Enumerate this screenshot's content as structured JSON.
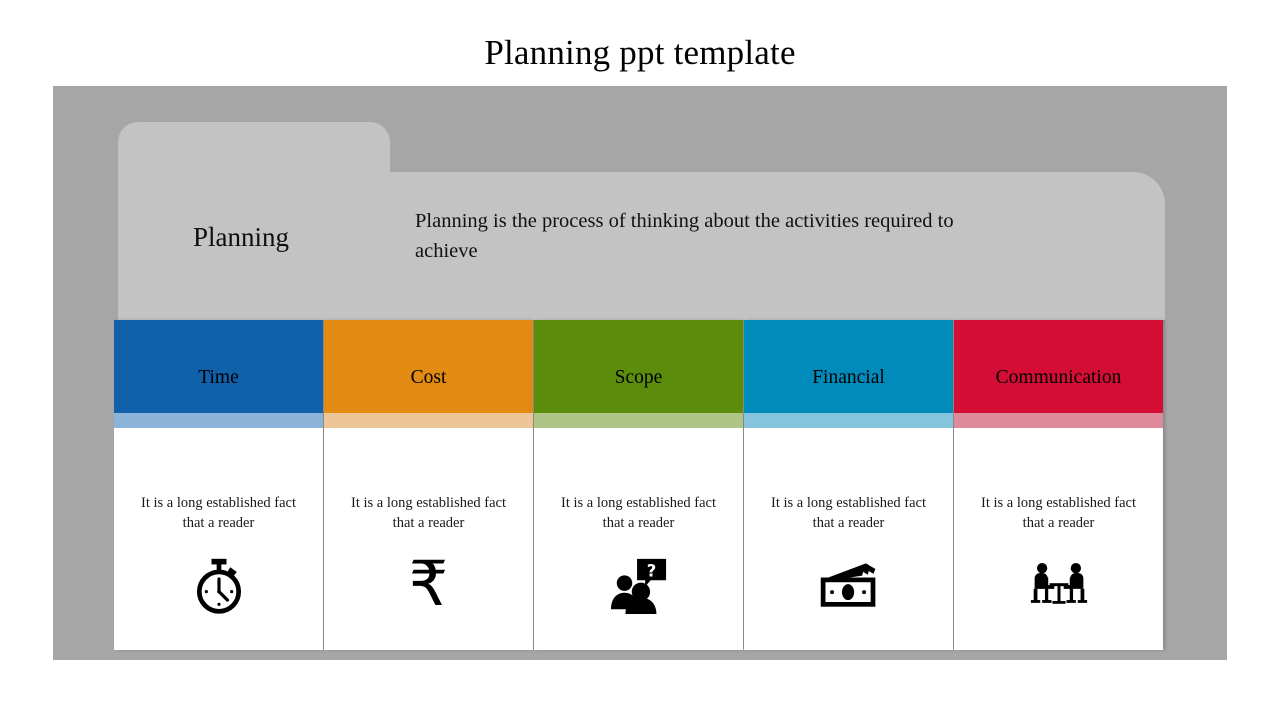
{
  "slide": {
    "title": "Planning ppt template",
    "background_color": "#ffffff",
    "frame_color": "#a6a6a6",
    "panel_color": "#c3c3c3"
  },
  "header": {
    "heading": "Planning",
    "description": "Planning is the process of thinking about the activities required to achieve"
  },
  "cards": [
    {
      "label": "Time",
      "text": "It is a long established fact that a reader",
      "color": "#1060aa",
      "tint": "#8cb4d8",
      "icon": "stopwatch-icon"
    },
    {
      "label": "Cost",
      "text": "It is a long established fact that a reader",
      "color": "#e28a11",
      "tint": "#eec596",
      "icon": "rupee-icon",
      "glyph": "₹"
    },
    {
      "label": "Scope",
      "text": "It is a long established fact that a reader",
      "color": "#5c8c0b",
      "tint": "#aec585",
      "icon": "people-question-icon"
    },
    {
      "label": "Financial",
      "text": "It is a long established fact that a reader",
      "color": "#008bba",
      "tint": "#85c4dd",
      "icon": "banknotes-icon"
    },
    {
      "label": "Communication",
      "text": "It is a long established fact that a reader",
      "color": "#d40d35",
      "tint": "#df8a9a",
      "icon": "meeting-table-icon"
    }
  ]
}
